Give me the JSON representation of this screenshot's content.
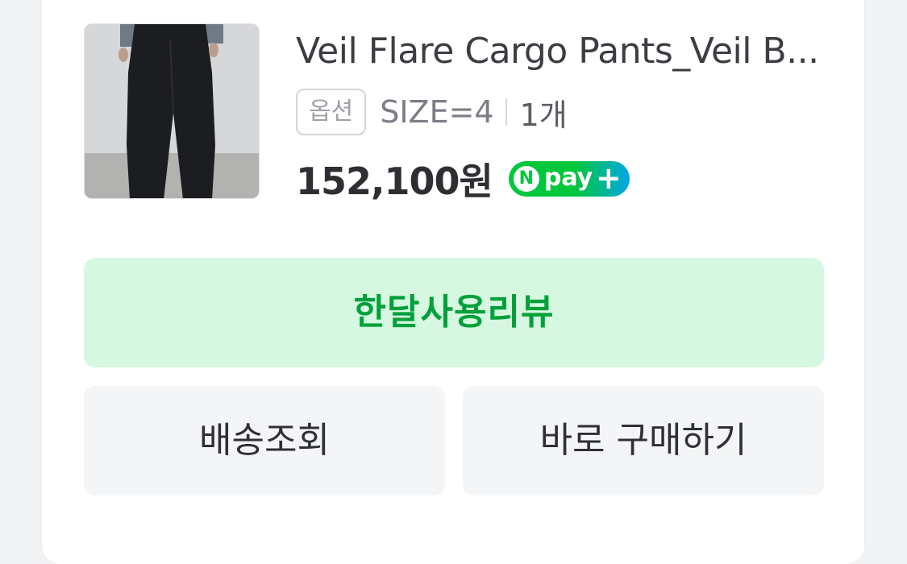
{
  "product": {
    "title": "Veil Flare Cargo Pants_Veil B...",
    "option_badge": "옵션",
    "option_value": "SIZE=4",
    "quantity": "1개",
    "price": "152,100원"
  },
  "npay": {
    "n_letter": "N",
    "label": "pay",
    "plus": "+",
    "colors": {
      "green": "#00c73c",
      "blue": "#00a6e5"
    }
  },
  "actions": {
    "review_label": "한달사용리뷰",
    "track_label": "배송조회",
    "buy_label": "바로 구매하기"
  },
  "colors": {
    "review_bg": "#d6f8e0",
    "review_text": "#00a03a",
    "gray_button_bg": "#f4f5f7"
  }
}
